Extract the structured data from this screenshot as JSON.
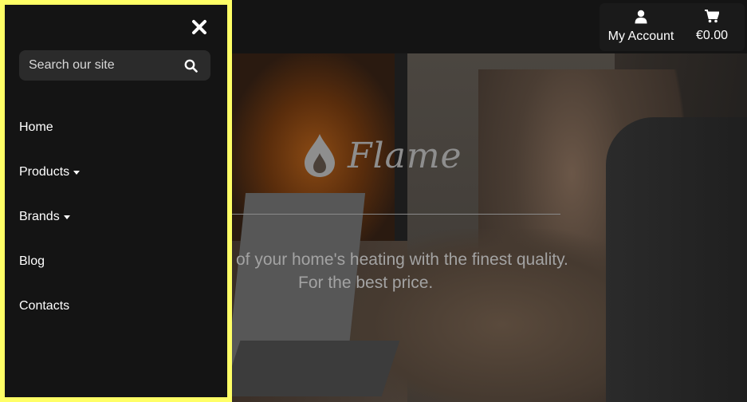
{
  "header": {
    "account_label": "My Account",
    "cart_total": "€0.00"
  },
  "hero": {
    "logo_text": "Flame",
    "tagline_line1": "of your home's heating with the finest quality.",
    "tagline_line2": "For the best price."
  },
  "sidemenu": {
    "search_placeholder": "Search our site",
    "items": [
      {
        "label": "Home",
        "dropdown": false
      },
      {
        "label": "Products",
        "dropdown": true
      },
      {
        "label": "Brands",
        "dropdown": true
      },
      {
        "label": "Blog",
        "dropdown": false
      },
      {
        "label": "Contacts",
        "dropdown": false
      }
    ]
  },
  "colors": {
    "menu_border": "#ffff66",
    "background": "#141414",
    "search_bg": "#2b2b2b"
  },
  "icons": [
    "close-icon",
    "search-icon",
    "user-icon",
    "cart-icon",
    "flame-drop-icon",
    "chevron-down-icon"
  ]
}
